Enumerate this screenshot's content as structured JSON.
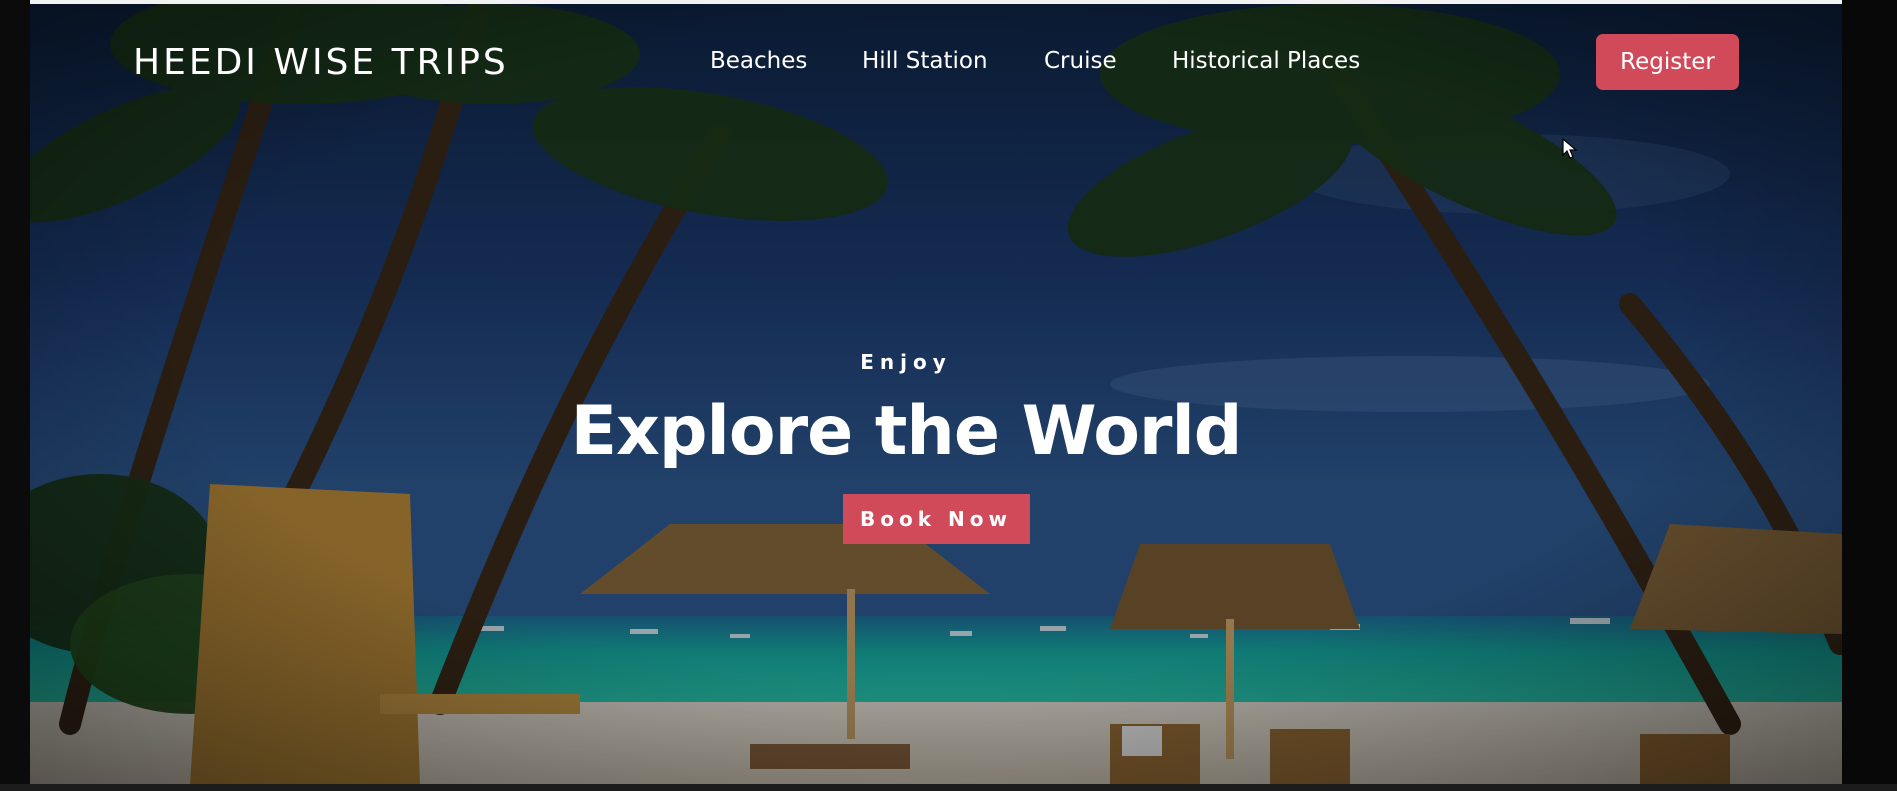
{
  "brand": {
    "name": "HEEDI WISE TRIPS"
  },
  "nav": {
    "items": [
      {
        "label": "Beaches"
      },
      {
        "label": "Hill Station"
      },
      {
        "label": "Cruise"
      },
      {
        "label": "Historical Places"
      }
    ],
    "register_label": "Register"
  },
  "hero": {
    "eyebrow": "Enjoy",
    "headline": "Explore the World",
    "cta_label": "Book Now",
    "background": "tropical-beach-photo"
  },
  "colors": {
    "accent": "#d14a5a",
    "text": "#ffffff",
    "sky": "#1d3a6e",
    "sea": "#1fb7a8",
    "sand": "#e9e2d4"
  }
}
